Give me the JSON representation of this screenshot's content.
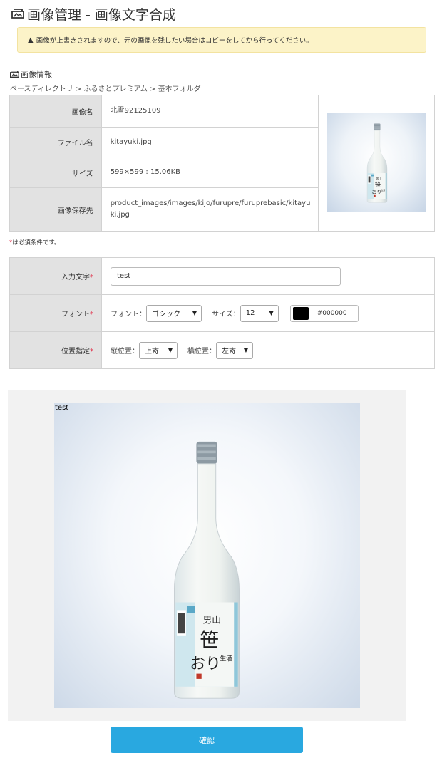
{
  "header": {
    "title": "画像管理 - 画像文字合成"
  },
  "warning": {
    "icon": "▲",
    "text": "画像が上書きされますので、元の画像を残したい場合はコピーをしてから行ってください。"
  },
  "image_info": {
    "section_title": "画像情報",
    "breadcrumb": "ベースディレクトリ > ふるさとプレミアム > 基本フォルダ",
    "rows": [
      {
        "label": "画像名",
        "value": "北雪92125109"
      },
      {
        "label": "ファイル名",
        "value": "kitayuki.jpg"
      },
      {
        "label": "サイズ",
        "value": "599×599 : 15.06KB"
      },
      {
        "label": "画像保存先",
        "value": "product_images/images/kijo/furupre/furuprebasic/kitayuki.jpg"
      }
    ]
  },
  "required_note": {
    "mark": "*",
    "text": "は必須条件です。"
  },
  "form": {
    "text_row": {
      "label": "入力文字",
      "mark": "*",
      "value": "test"
    },
    "font_row": {
      "label": "フォント",
      "mark": "*",
      "font_label": "フォント：",
      "font_value": "ゴシック",
      "size_label": "サイズ：",
      "size_value": "12",
      "color_value": "#000000"
    },
    "position_row": {
      "label": "位置指定",
      "mark": "*",
      "vertical_label": "縦位置：",
      "vertical_value": "上寄",
      "horizontal_label": "横位置：",
      "horizontal_value": "左寄"
    }
  },
  "preview": {
    "overlay_text": "test"
  },
  "actions": {
    "confirm_label": "確認"
  },
  "colors": {
    "accent": "#29a8e0",
    "required": "#e0304a",
    "warning_bg": "#fcf3c8"
  }
}
